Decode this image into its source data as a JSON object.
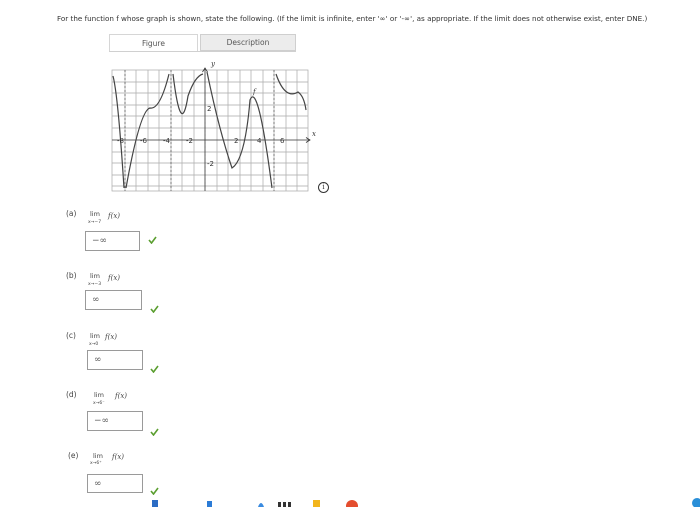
{
  "instructions": "For the function f whose graph is shown, state the following. (If the limit is infinite, enter '∞' or '-∞', as appropriate. If the limit does not otherwise exist, enter DNE.)",
  "tabs": {
    "figure": "Figure",
    "description": "Description"
  },
  "graph": {
    "y_label": "y",
    "x_label": "x",
    "f_label": "f",
    "x_ticks": [
      "-8",
      "-6",
      "-4",
      "-2",
      "2",
      "4",
      "6"
    ],
    "y_ticks": [
      "2",
      "-2"
    ]
  },
  "info_icon": "i",
  "parts": [
    {
      "letter": "(a)",
      "lim": "lim",
      "sub": "x→−7",
      "fx": "f(x)",
      "answer": "−∞"
    },
    {
      "letter": "(b)",
      "lim": "lim",
      "sub": "x→−3",
      "fx": "f(x)",
      "answer": "∞"
    },
    {
      "letter": "(c)",
      "lim": "lim",
      "sub": "x→0",
      "fx": "f(x)",
      "answer": "∞"
    },
    {
      "letter": "(d)",
      "lim": "lim",
      "sub": "x→6⁻",
      "fx": "f(x)",
      "answer": "−∞"
    },
    {
      "letter": "(e)",
      "lim": "lim",
      "sub": "x→6⁺",
      "fx": "f(x)",
      "answer": "∞"
    }
  ],
  "colors": {
    "check": "#5a9e2f",
    "grid": "#9c9c9c",
    "curve": "#444444"
  }
}
